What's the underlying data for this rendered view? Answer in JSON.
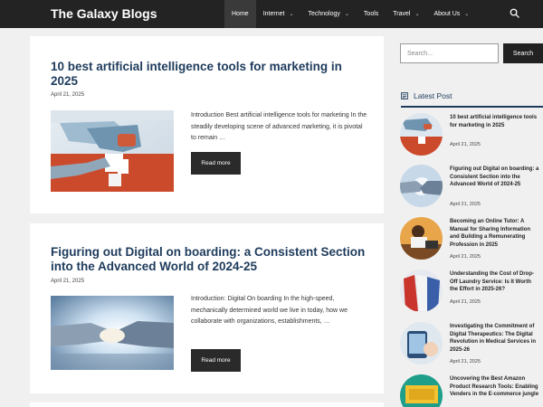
{
  "header": {
    "brand": "The Galaxy Blogs",
    "nav": [
      {
        "label": "Home",
        "dropdown": false,
        "active": true
      },
      {
        "label": "Internet",
        "dropdown": true,
        "active": false
      },
      {
        "label": "Technology",
        "dropdown": true,
        "active": false
      },
      {
        "label": "Tools",
        "dropdown": false,
        "active": false
      },
      {
        "label": "Travel",
        "dropdown": true,
        "active": false
      },
      {
        "label": "About Us",
        "dropdown": true,
        "active": false
      }
    ],
    "search_icon": "search-icon"
  },
  "posts": [
    {
      "title": "10 best artificial intelligence tools for marketing in 2025",
      "date": "April 21, 2025",
      "excerpt": "Introduction Best artificial intelligence tools for marketing In the steadily developing scene of advanced marketing, it is pivotal to remain …",
      "read_more": "Read more",
      "image": "robot-hand-puzzle"
    },
    {
      "title": "Figuring out Digital on boarding: a Consistent Section into the Advanced World of 2024-25",
      "date": "April 21, 2025",
      "excerpt": "Introduction: Digital On boarding In the high-speed, mechanically determined world we live in today, how we collaborate with organizations, establishments, …",
      "read_more": "Read more",
      "image": "digital-handshake"
    }
  ],
  "sidebar": {
    "search_placeholder": "Search...",
    "search_button": "Search",
    "widget_title": "Latest Post",
    "widget_icon": "document-icon",
    "items": [
      {
        "title": "10 best artificial intelligence tools for marketing in 2025",
        "date": "April 21, 2025",
        "image": "robot-hand-puzzle"
      },
      {
        "title": "Figuring out Digital on boarding: a Consistent Section into the Advanced World of 2024-25",
        "date": "April 21, 2025",
        "image": "digital-handshake"
      },
      {
        "title": "Becoming an Online Tutor: A Manual for Sharing Information and Building a Remunerating Profession in 2025",
        "date": "April 21, 2025",
        "image": "online-tutor"
      },
      {
        "title": "Understanding the Cost of Drop-Off Laundry Service: Is It Worth the Effort in 2025-26?",
        "date": "April 21, 2025",
        "image": "laundry-shirts"
      },
      {
        "title": "Investigating the Commitment of Digital Therapeutics: The Digital Revolution in Medical Services in 2025-26",
        "date": "April 21, 2025",
        "image": "digital-therapeutics"
      },
      {
        "title": "Uncovering the Best Amazon Product Research Tools: Enabling Venders in the E-commerce jungle",
        "date": "",
        "image": "amazon-tools"
      }
    ]
  },
  "colors": {
    "header_bg": "#232323",
    "title_blue": "#1e3b5c",
    "button_dark": "#2a2a2a",
    "page_bg": "#f0f0f0"
  }
}
